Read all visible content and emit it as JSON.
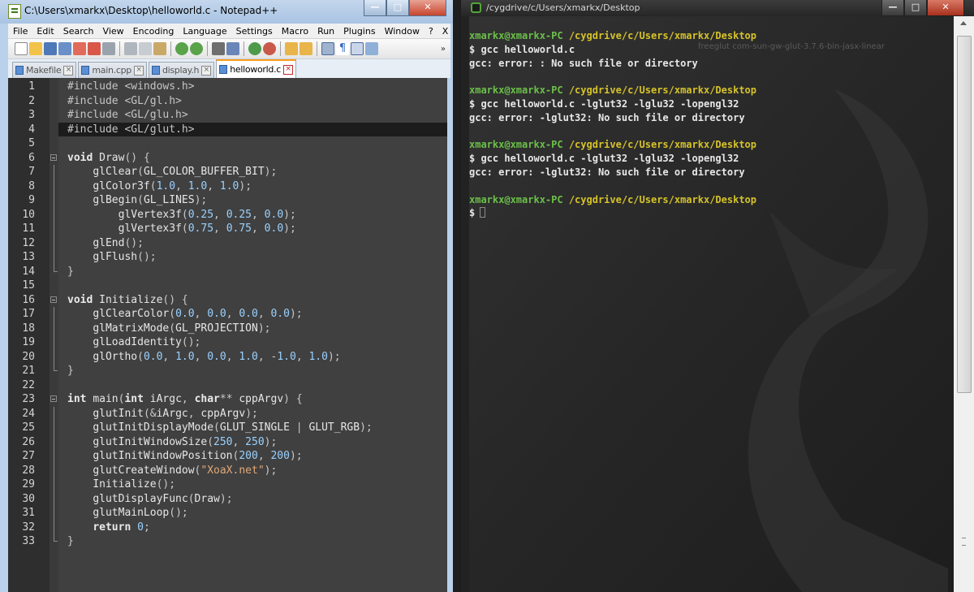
{
  "notepad": {
    "title": "C:\\Users\\xmarkx\\Desktop\\helloworld.c - Notepad++",
    "menu": [
      "File",
      "Edit",
      "Search",
      "View",
      "Encoding",
      "Language",
      "Settings",
      "Macro",
      "Run",
      "Plugins",
      "Window",
      "?"
    ],
    "menu_close": "X",
    "toolbar_more": "»",
    "tabs": [
      {
        "label": "Makefile",
        "active": false
      },
      {
        "label": "main.cpp",
        "active": false
      },
      {
        "label": "display.h",
        "active": false
      },
      {
        "label": "helloworld.c",
        "active": true
      }
    ],
    "current_line": 4,
    "code": [
      "#include <windows.h>",
      "#include <GL/gl.h>",
      "#include <GL/glu.h>",
      "#include <GL/glut.h>",
      "",
      "void Draw() {",
      "    glClear(GL_COLOR_BUFFER_BIT);",
      "    glColor3f(1.0, 1.0, 1.0);",
      "    glBegin(GL_LINES);",
      "        glVertex3f(0.25, 0.25, 0.0);",
      "        glVertex3f(0.75, 0.75, 0.0);",
      "    glEnd();",
      "    glFlush();",
      "}",
      "",
      "void Initialize() {",
      "    glClearColor(0.0, 0.0, 0.0, 0.0);",
      "    glMatrixMode(GL_PROJECTION);",
      "    glLoadIdentity();",
      "    glOrtho(0.0, 1.0, 0.0, 1.0, -1.0, 1.0);",
      "}",
      "",
      "int main(int iArgc, char** cppArgv) {",
      "    glutInit(&iArgc, cppArgv);",
      "    glutInitDisplayMode(GLUT_SINGLE | GLUT_RGB);",
      "    glutInitWindowSize(250, 250);",
      "    glutInitWindowPosition(200, 200);",
      "    glutCreateWindow(\"XoaX.net\");",
      "    Initialize();",
      "    glutDisplayFunc(Draw);",
      "    glutMainLoop();",
      "    return 0;",
      "}"
    ],
    "folds": {
      "6": "start",
      "14": "end",
      "16": "start",
      "21": "end",
      "23": "start",
      "33": "end"
    }
  },
  "terminal": {
    "title": "/cygdrive/c/Users/xmarkx/Desktop",
    "background_text": "freeglut     com-sun-gw-glut-3.7.6-bin-jasx-linear",
    "lines": [
      {
        "type": "prompt",
        "user": "xmarkx@xmarkx-PC",
        "path": "/cygdrive/c/Users/xmarkx/Desktop"
      },
      {
        "type": "out",
        "text": "$ gcc helloworld.c"
      },
      {
        "type": "out",
        "text": "gcc: error: : No such file or directory"
      },
      {
        "type": "blank",
        "text": ""
      },
      {
        "type": "prompt",
        "user": "xmarkx@xmarkx-PC",
        "path": "/cygdrive/c/Users/xmarkx/Desktop"
      },
      {
        "type": "out",
        "text": "$ gcc helloworld.c -lglut32 -lglu32 -lopengl32"
      },
      {
        "type": "out",
        "text": "gcc: error: -lglut32: No such file or directory"
      },
      {
        "type": "blank",
        "text": ""
      },
      {
        "type": "prompt",
        "user": "xmarkx@xmarkx-PC",
        "path": "/cygdrive/c/Users/xmarkx/Desktop"
      },
      {
        "type": "out",
        "text": "$ gcc helloworld.c -lglut32 -lglu32 -lopengl32"
      },
      {
        "type": "out",
        "text": "gcc: error: -lglut32: No such file or directory"
      },
      {
        "type": "blank",
        "text": ""
      },
      {
        "type": "prompt",
        "user": "xmarkx@xmarkx-PC",
        "path": "/cygdrive/c/Users/xmarkx/Desktop"
      },
      {
        "type": "input",
        "text": "$"
      }
    ]
  },
  "colors": {
    "prompt_user": "#6cc04a",
    "prompt_path": "#d6c32a",
    "active_tab_accent": "#fa9c1a"
  }
}
